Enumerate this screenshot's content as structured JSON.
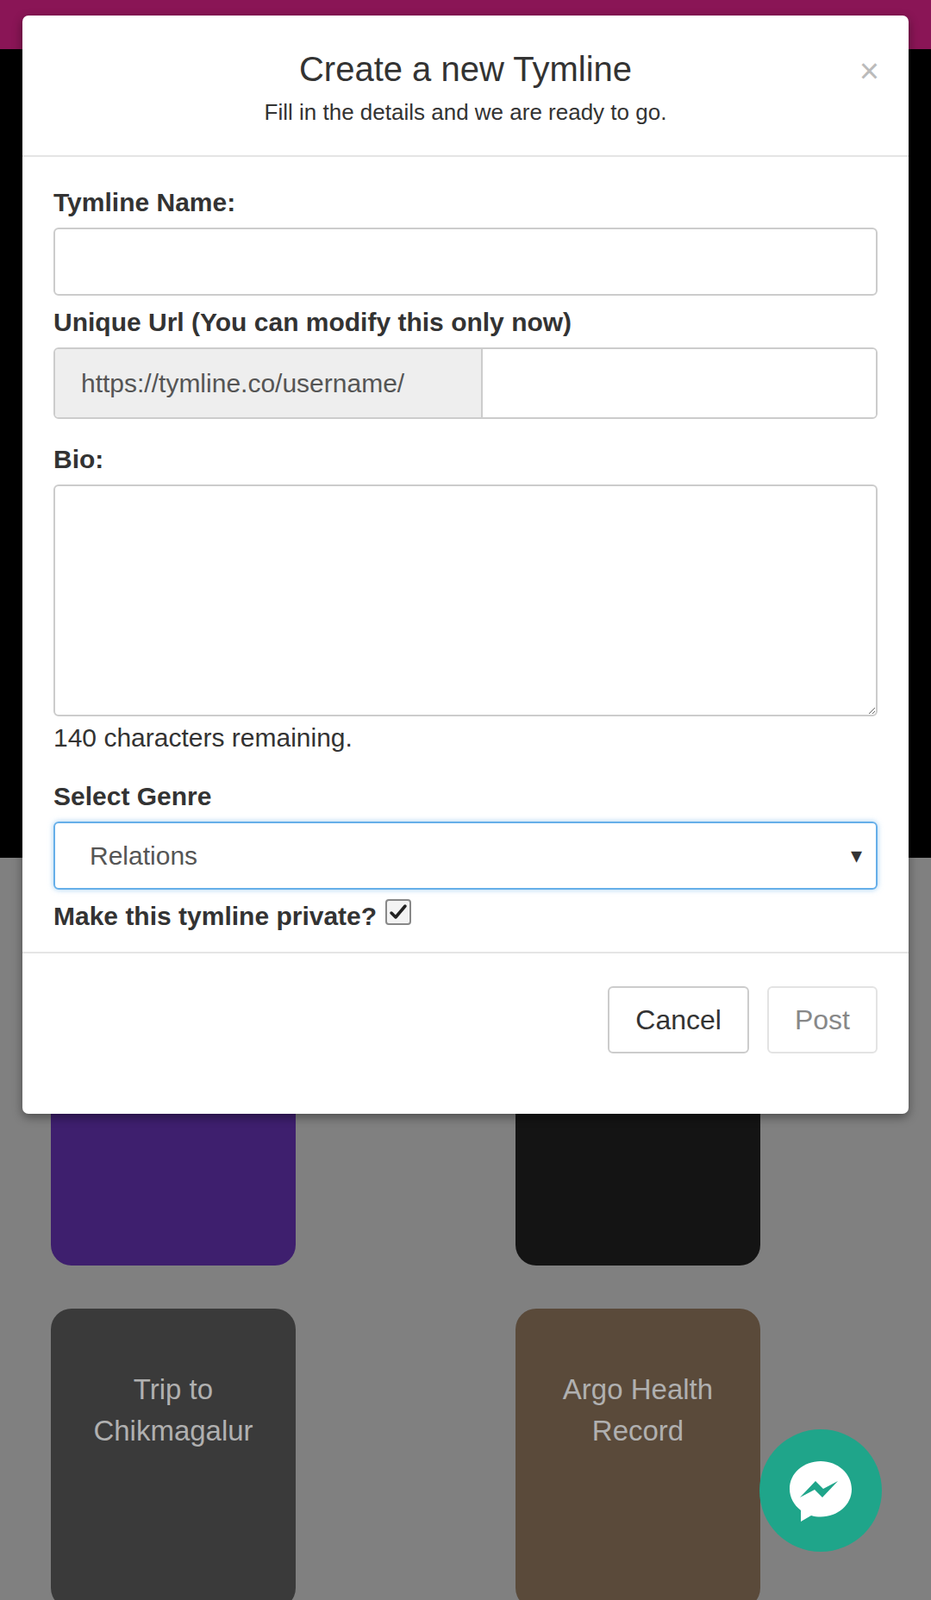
{
  "modal": {
    "title": "Create a new Tymline",
    "subtitle": "Fill in the details and we are ready to go.",
    "close": "×"
  },
  "fields": {
    "name_label": "Tymline Name:",
    "name_value": "",
    "url_label": "Unique Url (You can modify this only now)",
    "url_prefix": "https://tymline.co/username/",
    "url_value": "",
    "bio_label": "Bio:",
    "bio_value": "",
    "counter": "140 characters remaining.",
    "genre_label": "Select Genre",
    "genre_value": "Relations",
    "genre_arrow": "▾",
    "private_label": "Make this tymline private?",
    "private_checked": true
  },
  "buttons": [
    {
      "label": "Cancel",
      "disabled": false
    },
    {
      "label": "Post",
      "disabled": true
    }
  ],
  "cards": [
    {
      "title": ""
    },
    {
      "title": ""
    },
    {
      "title": "Trip to Chikmagalur"
    },
    {
      "title": "Argo Health Record"
    }
  ]
}
